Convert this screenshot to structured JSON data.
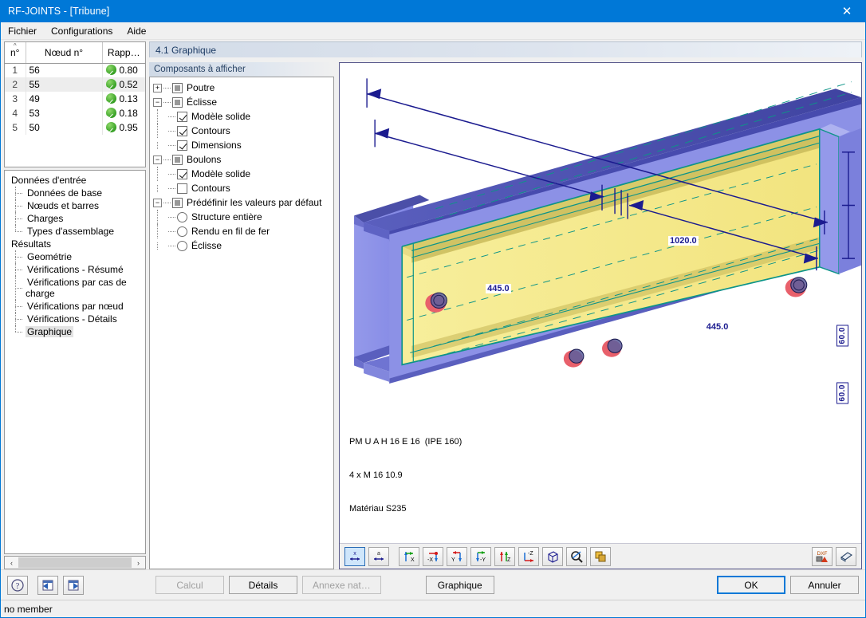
{
  "window": {
    "title": "RF-JOINTS - [Tribune]",
    "close_label": "✕",
    "accent": "#0078d7"
  },
  "menu": {
    "items": [
      {
        "label": "Fichier"
      },
      {
        "label": "Configurations"
      },
      {
        "label": "Aide"
      }
    ]
  },
  "grid": {
    "columns": [
      {
        "label": "n°"
      },
      {
        "label": "Nœud n°"
      },
      {
        "label": "Rapp…"
      }
    ],
    "rows": [
      {
        "no": "1",
        "node": "56",
        "ratio": "0.80",
        "selected": false
      },
      {
        "no": "2",
        "node": "55",
        "ratio": "0.52",
        "selected": true
      },
      {
        "no": "3",
        "node": "49",
        "ratio": "0.13",
        "selected": false
      },
      {
        "no": "4",
        "node": "53",
        "ratio": "0.18",
        "selected": false
      },
      {
        "no": "5",
        "node": "50",
        "ratio": "0.95",
        "selected": false
      }
    ]
  },
  "nav": {
    "groups": [
      {
        "label": "Données d'entrée",
        "items": [
          {
            "label": "Données de base",
            "active": false
          },
          {
            "label": "Nœuds et barres",
            "active": false
          },
          {
            "label": "Charges",
            "active": false
          },
          {
            "label": "Types d'assemblage",
            "active": false
          }
        ]
      },
      {
        "label": "Résultats",
        "items": [
          {
            "label": "Geométrie",
            "active": false
          },
          {
            "label": "Vérifications - Résumé",
            "active": false
          },
          {
            "label": "Vérifications par cas de charge",
            "active": false
          },
          {
            "label": "Vérifications par nœud",
            "active": false
          },
          {
            "label": "Vérifications - Détails",
            "active": false
          },
          {
            "label": "Graphique",
            "active": true
          }
        ]
      }
    ]
  },
  "section": {
    "header": "4.1 Graphique"
  },
  "components": {
    "caption": "Composants à afficher",
    "nodes": [
      {
        "label": "Poutre",
        "kind": "tri",
        "level": 0,
        "expander": "+"
      },
      {
        "label": "Éclisse",
        "kind": "tri",
        "level": 0,
        "expander": "−"
      },
      {
        "label": "Modèle solide",
        "kind": "checked",
        "level": 1
      },
      {
        "label": "Contours",
        "kind": "checked",
        "level": 1
      },
      {
        "label": "Dimensions",
        "kind": "checked",
        "level": 1,
        "last": true
      },
      {
        "label": "Boulons",
        "kind": "tri",
        "level": 0,
        "expander": "−"
      },
      {
        "label": "Modèle solide",
        "kind": "checked",
        "level": 1
      },
      {
        "label": "Contours",
        "kind": "unchecked",
        "level": 1,
        "last": true
      },
      {
        "label": "Prédéfinir les valeurs par défaut",
        "kind": "tri",
        "level": 0,
        "expander": "−"
      },
      {
        "label": "Structure entière",
        "kind": "radio",
        "level": 1
      },
      {
        "label": "Rendu en fil de fer",
        "kind": "radio",
        "level": 1
      },
      {
        "label": "Éclisse",
        "kind": "radio",
        "level": 1,
        "last": true
      }
    ]
  },
  "viewport": {
    "caption_line1": "PM U A H 16 E 16  (IPE 160)",
    "caption_line2": "4 x M 16 10.9",
    "caption_line3": "Matériau S235",
    "dimensions": {
      "overall": "1020.0",
      "left": "445.0",
      "right": "445.0",
      "vertical_top": "60.0",
      "vertical_bottom": "60.0"
    },
    "colors": {
      "beam": "#7b7fe0",
      "beam_dark": "#4b4fa8",
      "plate": "#f5e98c",
      "plate_dark": "#b5a845",
      "contour": "#0d9488",
      "bolt": "#e8606b",
      "dimension": "#1b1b8f"
    }
  },
  "view_toolbar": {
    "buttons": [
      {
        "name": "dimension-x-icon",
        "label": "x",
        "selected": true
      },
      {
        "name": "dimension-a-icon",
        "label": "a",
        "selected": false
      },
      {
        "name": "view-x-icon",
        "label": "X",
        "selected": false
      },
      {
        "name": "view-minus-x-icon",
        "label": "-X",
        "selected": false
      },
      {
        "name": "view-y-icon",
        "label": "Y",
        "selected": false
      },
      {
        "name": "view-minus-y-icon",
        "label": "-Y",
        "selected": false
      },
      {
        "name": "view-z-icon",
        "label": "Z",
        "selected": false
      },
      {
        "name": "view-minus-z-icon",
        "label": "-Z",
        "selected": false
      },
      {
        "name": "isometric-view-icon",
        "label": "",
        "selected": false
      },
      {
        "name": "zoom-all-icon",
        "label": "",
        "selected": false
      },
      {
        "name": "render-mode-icon",
        "label": "",
        "selected": false
      }
    ],
    "right_buttons": [
      {
        "name": "dxf-export-icon",
        "label": "DXF"
      },
      {
        "name": "print-icon",
        "label": ""
      }
    ]
  },
  "bottom": {
    "help_label": "?",
    "prev_label": "◀",
    "next_label": "▶",
    "buttons": [
      {
        "label": "Calcul",
        "disabled": true,
        "default": false
      },
      {
        "label": "Détails",
        "disabled": false,
        "default": false
      },
      {
        "label": "Annexe nat…",
        "disabled": true,
        "default": false
      },
      {
        "label": "Graphique",
        "disabled": false,
        "default": false
      },
      {
        "label": "OK",
        "disabled": false,
        "default": true
      },
      {
        "label": "Annuler",
        "disabled": false,
        "default": false
      }
    ]
  },
  "statusbar": {
    "text": "no member"
  },
  "scrollbar": {
    "left_arrow": "‹",
    "right_arrow": "›"
  }
}
